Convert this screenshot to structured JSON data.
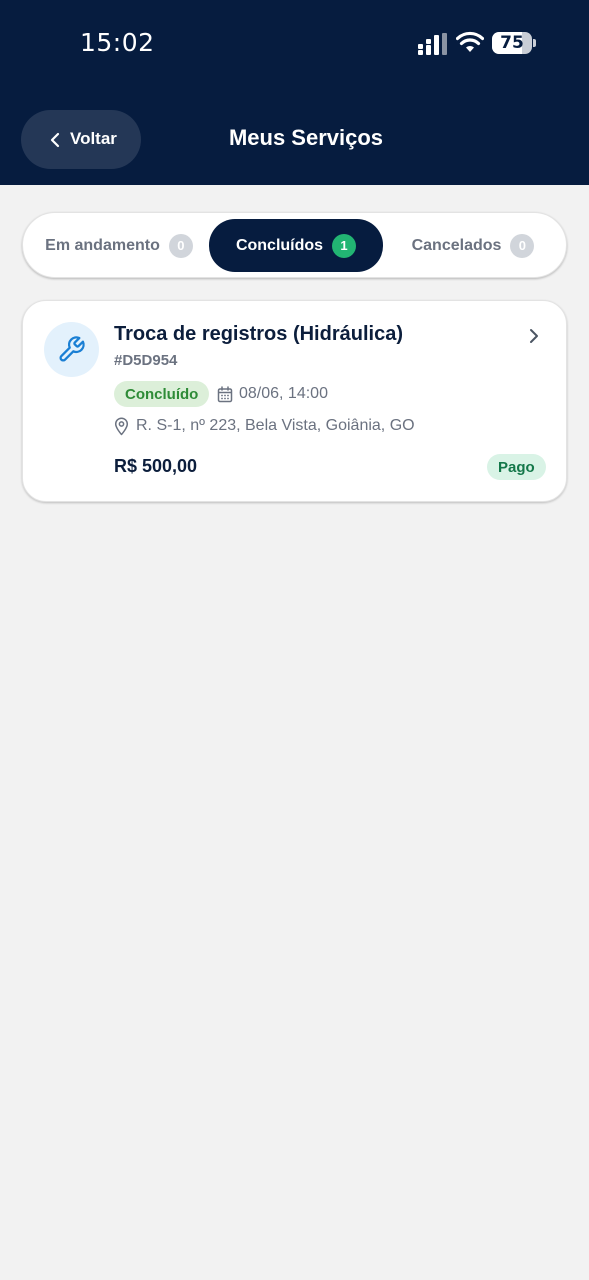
{
  "status_bar": {
    "time": "15:02",
    "battery": "75",
    "battery_level": 0.75
  },
  "header": {
    "back_label": "Voltar",
    "title": "Meus Serviços"
  },
  "tabs": [
    {
      "label": "Em andamento",
      "count": "0",
      "active": false
    },
    {
      "label": "Concluídos",
      "count": "1",
      "active": true
    },
    {
      "label": "Cancelados",
      "count": "0",
      "active": false
    }
  ],
  "services": [
    {
      "icon": "wrench-icon",
      "title": "Troca de registros (Hidráulica)",
      "code": "#D5D954",
      "status": "Concluído",
      "date": "08/06, 14:00",
      "address": "R. S-1, nº 223, Bela Vista, Goiânia, GO",
      "price": "R$ 500,00",
      "payment_status": "Pago"
    }
  ],
  "colors": {
    "header_bg": "#061c3f",
    "active_tab_bg": "#061c3f",
    "active_count_bg": "#22b573",
    "status_badge_bg": "#dcefd9",
    "payment_badge_bg": "#d9f3e6"
  }
}
